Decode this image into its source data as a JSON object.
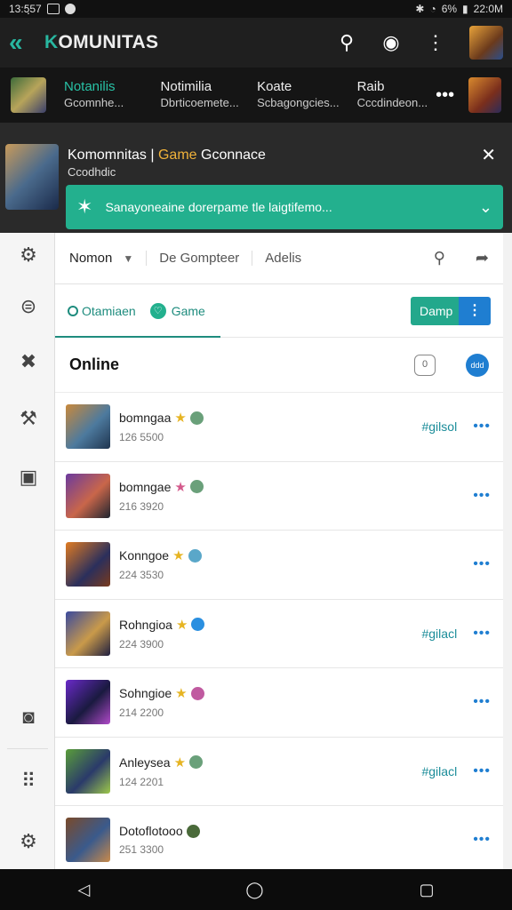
{
  "status_bar": {
    "time_left": "13:5ฺ57",
    "time_right": "22:0M",
    "battery": "6%"
  },
  "app_bar": {
    "title_prefix": "K",
    "title_rest": "OMUNITAS"
  },
  "channels": [
    {
      "name": "Notanilis",
      "sub": "Gcomnhe...",
      "active": true
    },
    {
      "name": "Notimilia",
      "sub": "Dbrticoemete...",
      "active": false
    },
    {
      "name": "Koate",
      "sub": "Scbagongcies...",
      "active": false
    },
    {
      "name": "Raib",
      "sub": "Cccdindeon...",
      "active": false
    }
  ],
  "banner": {
    "title_a": "Komomnitas | ",
    "title_game": "Game",
    "title_b": " Gconnace",
    "subtitle": "Ccodhdic",
    "notice": "Sanayoneaine dorerpame tle laigtifemo..."
  },
  "tabs": {
    "t1": "Nomon",
    "t2": "De Gompteer",
    "t3": "Adelis"
  },
  "filters": {
    "f1": "Otamiaen",
    "f2": "Game",
    "button": "Damp"
  },
  "online": {
    "title": "Online",
    "sq_label": "0",
    "badge": "ddd"
  },
  "members": [
    {
      "name": "bomngaa",
      "num": "126 5500",
      "star": "★",
      "star_color": "gold",
      "badge": "#6aa07a",
      "tag": "#gilsol",
      "av": "linear-gradient(135deg,#c9893c,#4d7a9e 55%,#1f3550)"
    },
    {
      "name": "bomngae",
      "num": "216 3920",
      "star": "★",
      "star_color": "pink",
      "badge": "#6aa07a",
      "tag": "",
      "av": "linear-gradient(135deg,#6b3a9e,#c9664a 55%,#1f2530)"
    },
    {
      "name": "Konngoe",
      "num": "224 3530",
      "star": "★",
      "star_color": "gold",
      "badge": "#5aa7c9",
      "tag": "",
      "av": "linear-gradient(135deg,#e07b22,#2b2f5c 60%,#7a3a1c)"
    },
    {
      "name": "Rohngioa",
      "num": "224 3900",
      "star": "★",
      "star_color": "gold",
      "badge": "#2a8fe0",
      "tag": "#gilacl",
      "av": "linear-gradient(135deg,#3a4a9e,#c99a4a 55%,#1f1f40)"
    },
    {
      "name": "Sohngioe",
      "num": "214 2200",
      "star": "★",
      "star_color": "gold",
      "badge": "#c05aa0",
      "tag": "",
      "av": "linear-gradient(135deg,#6a2ac9,#1a1a40 55%,#b04ac9)"
    },
    {
      "name": "Anleysea",
      "num": "124 2201",
      "star": "★",
      "star_color": "gold",
      "badge": "#6aa07a",
      "tag": "#gilacl",
      "av": "linear-gradient(135deg,#5a9e3a,#2a3a6a 55%,#9ec94a)"
    },
    {
      "name": "Dotoflotooo",
      "num": "251 3300",
      "star": "",
      "star_color": "gold",
      "badge": "#4a6a3a",
      "tag": "",
      "av": "linear-gradient(135deg,#7a4a2a,#3a5a8c 55%,#c98a4a)"
    }
  ]
}
